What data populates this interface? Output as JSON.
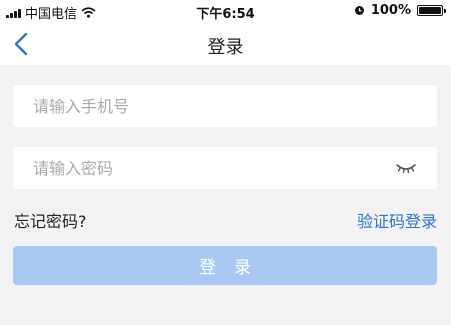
{
  "status_bar": {
    "carrier": "中国电信",
    "time": "下午6:54",
    "battery": "100%"
  },
  "nav": {
    "title": "登录"
  },
  "form": {
    "phone_placeholder": "请输入手机号",
    "password_placeholder": "请输入密码",
    "forgot_password": "忘记密码?",
    "code_login": "验证码登录",
    "login_button": "登录"
  },
  "colors": {
    "accent": "#2d73cf",
    "button_disabled": "#a9c8f1",
    "background": "#f2f2f4"
  },
  "icons": {
    "back": "chevron-left-icon",
    "password_visibility": "eye-closed-icon",
    "wifi": "wifi-icon",
    "alarm": "alarm-icon",
    "battery": "battery-icon"
  }
}
